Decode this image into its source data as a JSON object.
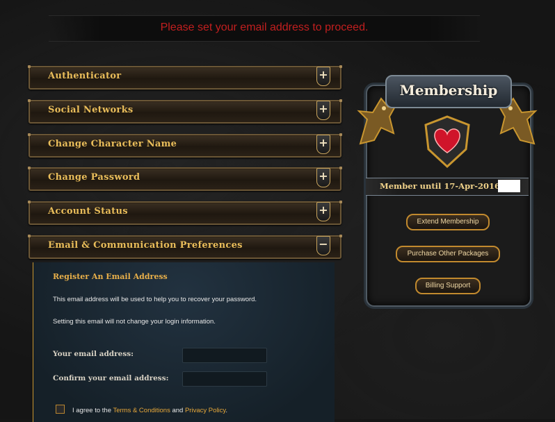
{
  "banner": {
    "message": "Please set your email address to proceed."
  },
  "accordion": {
    "items": [
      {
        "label": "Authenticator",
        "toggle": "+"
      },
      {
        "label": "Social Networks",
        "toggle": "+"
      },
      {
        "label": "Change Character Name",
        "toggle": "+"
      },
      {
        "label": "Change Password",
        "toggle": "+"
      },
      {
        "label": "Account Status",
        "toggle": "+"
      },
      {
        "label": "Email & Communication Preferences",
        "toggle": "−"
      }
    ]
  },
  "email_panel": {
    "title": "Register An Email Address",
    "info_1": "This email address will be used to help you to recover your password.",
    "info_2": "Setting this email will not change your login information.",
    "email_label": "Your email address:",
    "email_value": "",
    "confirm_label": "Confirm your email address:",
    "confirm_value": "",
    "agree_prefix": "I agree to the ",
    "terms_link": "Terms & Conditions",
    "agree_and": " and ",
    "privacy_link": "Privacy Policy",
    "agree_suffix": ".",
    "agree_checked": false
  },
  "membership": {
    "title": "Membership",
    "member_until": "Member until 17-Apr-2016",
    "buttons": {
      "extend": "Extend Membership",
      "purchase": "Purchase Other Packages",
      "billing": "Billing Support"
    }
  },
  "colors": {
    "accent_gold": "#e9bd5a",
    "banner_red": "#c21f1f",
    "panel_blue": "#1a2630"
  }
}
